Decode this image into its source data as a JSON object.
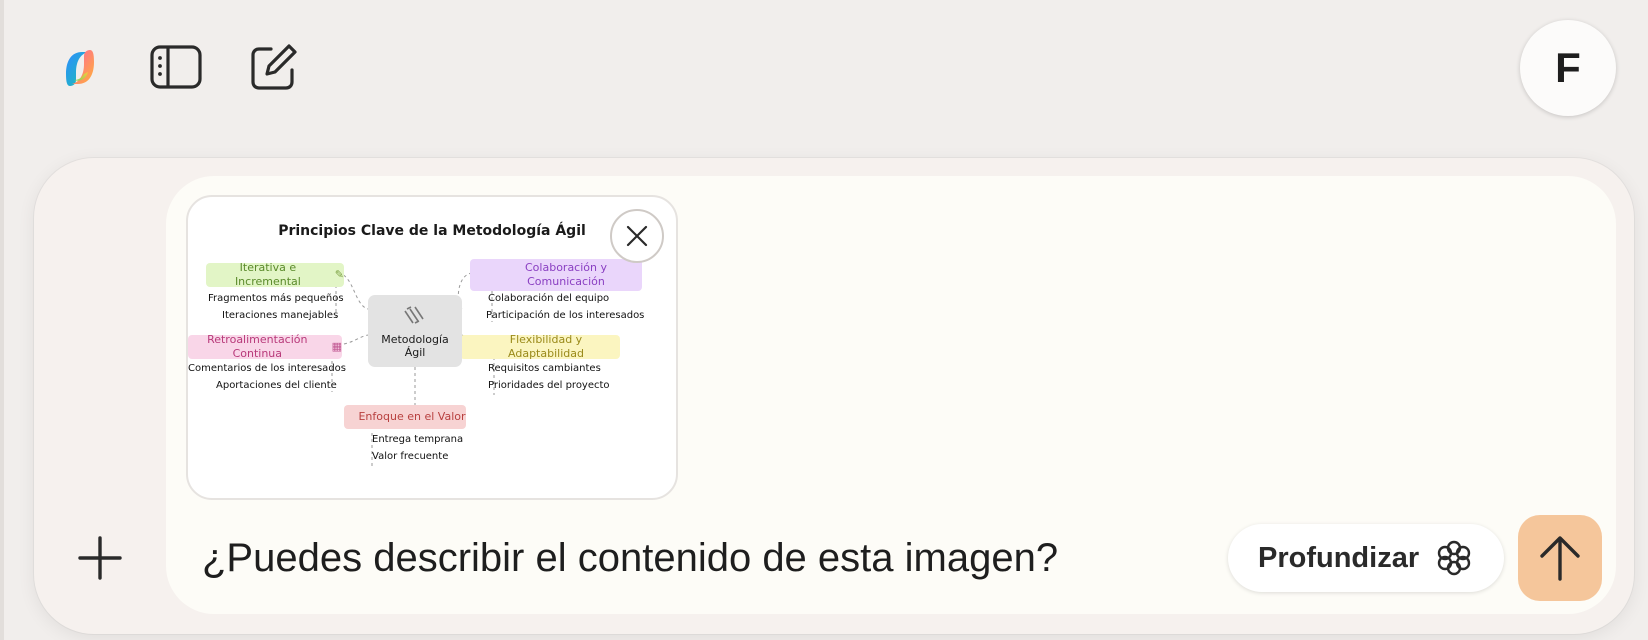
{
  "composer": {
    "prompt_text": "¿Puedes describir el contenido de esta imagen?",
    "deep_label": "Profundizar"
  },
  "user": {
    "avatar_initial": "F"
  },
  "icons": {
    "logo": "copilot-logo-icon",
    "sidebar": "sidebar-toggle-icon",
    "new_chat": "new-chat-icon",
    "plus": "plus-icon",
    "close": "close-icon",
    "deep": "deep-think-icon",
    "send": "arrow-up-icon"
  },
  "colors": {
    "send_button": "#f5c69b",
    "background": "#f1eeec",
    "composer_inner": "#fdfcf7"
  },
  "attachment": {
    "title": "Principios Clave de la Metodología Ágil",
    "center": {
      "line1": "Metodología",
      "line2": "Ágil"
    },
    "branches": [
      {
        "label": "Iterativa e Incremental",
        "color": "#e2f5c6",
        "text_color": "#5a8a2a",
        "items": [
          "Fragmentos más pequeños",
          "Iteraciones manejables"
        ]
      },
      {
        "label": "Colaboración y Comunicación",
        "color": "#ead6fb",
        "text_color": "#8a3fc2",
        "items": [
          "Colaboración del equipo",
          "Participación de los interesados"
        ]
      },
      {
        "label": "Retroalimentación Continua",
        "color": "#f9d6e8",
        "text_color": "#b83a7a",
        "items": [
          "Comentarios de los interesados",
          "Aportaciones del cliente"
        ]
      },
      {
        "label": "Flexibilidad y Adaptabilidad",
        "color": "#fbf5c0",
        "text_color": "#9a8a1a",
        "items": [
          "Requisitos cambiantes",
          "Prioridades del proyecto"
        ]
      },
      {
        "label": "Enfoque en el Valor",
        "color": "#f7d3d3",
        "text_color": "#b8403f",
        "items": [
          "Entrega temprana",
          "Valor frecuente"
        ]
      }
    ]
  }
}
